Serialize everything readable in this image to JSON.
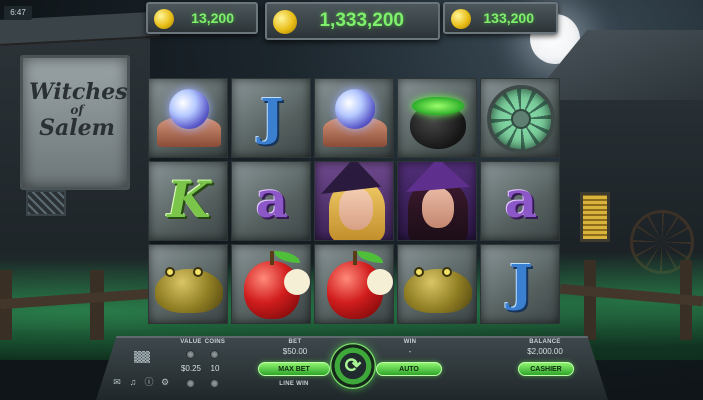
{
  "status": {
    "time": "6:47"
  },
  "sign": {
    "line1": "Witches",
    "line2": "of",
    "line3": "Salem"
  },
  "top_counters": {
    "left": "13,200",
    "center": "1,333,200",
    "right": "133,200"
  },
  "reels": [
    [
      "crystal-ball",
      "J",
      "crystal-ball",
      "cauldron",
      "stained-glass-window"
    ],
    [
      "K",
      "a",
      "blonde-witch",
      "dark-witch",
      "a"
    ],
    [
      "toad",
      "apple",
      "apple",
      "toad",
      "J"
    ]
  ],
  "bottom_bar": {
    "value_label": "VALUE",
    "coins_label": "COINS",
    "value": "$0.25",
    "coins": "10",
    "bet_label": "BET",
    "bet_value": "$50.00",
    "max_bet_label": "MAX BET",
    "line_win_label": "LINE WIN",
    "win_label": "WIN",
    "win_value": "-",
    "auto_label": "AUTO",
    "balance_label": "BALANCE",
    "balance_value": "$2,000.00",
    "cashier_label": "CASHIER"
  },
  "icons": {
    "spin": "refresh-icon",
    "paytable": "grid-icon",
    "settings": "gear-icon",
    "info": "info-icon",
    "sound": "speaker-icon",
    "chat": "chat-icon"
  },
  "colors": {
    "accent_green": "#7ff06b",
    "coin_gold": "#e8bd16",
    "frame_gray": "#55605f"
  }
}
